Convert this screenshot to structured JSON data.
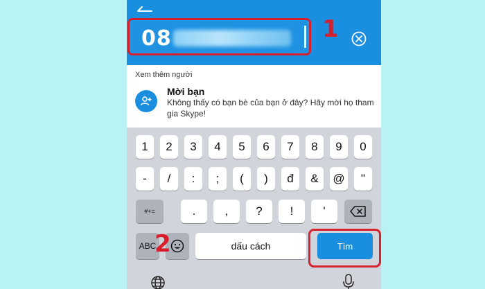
{
  "search": {
    "value_visible": "08",
    "value_hidden": "7••••••43"
  },
  "annotations": {
    "step1": "1",
    "step2": "2"
  },
  "suggestions": {
    "section_label": "Xem thêm người",
    "invite_title": "Mời bạn",
    "invite_desc": "Không thấy có bạn bè của bạn ở đây? Hãy mời họ tham gia Skype!"
  },
  "keyboard": {
    "row1": [
      "1",
      "2",
      "3",
      "4",
      "5",
      "6",
      "7",
      "8",
      "9",
      "0"
    ],
    "row2": [
      "-",
      "/",
      ":",
      ";",
      "(",
      ")",
      "đ",
      "&",
      "@",
      "\""
    ],
    "row3_left": "#+=",
    "row3": [
      ".",
      ",",
      "?",
      "!",
      "'"
    ],
    "abc": "ABC",
    "space": "dấu cách",
    "search": "Tìm"
  },
  "colors": {
    "accent": "#1a8fe0",
    "highlight": "#d6212f"
  },
  "icons": [
    "back-arrow-icon",
    "clear-icon",
    "add-person-icon",
    "emoji-icon",
    "backspace-icon",
    "globe-icon",
    "microphone-icon"
  ]
}
